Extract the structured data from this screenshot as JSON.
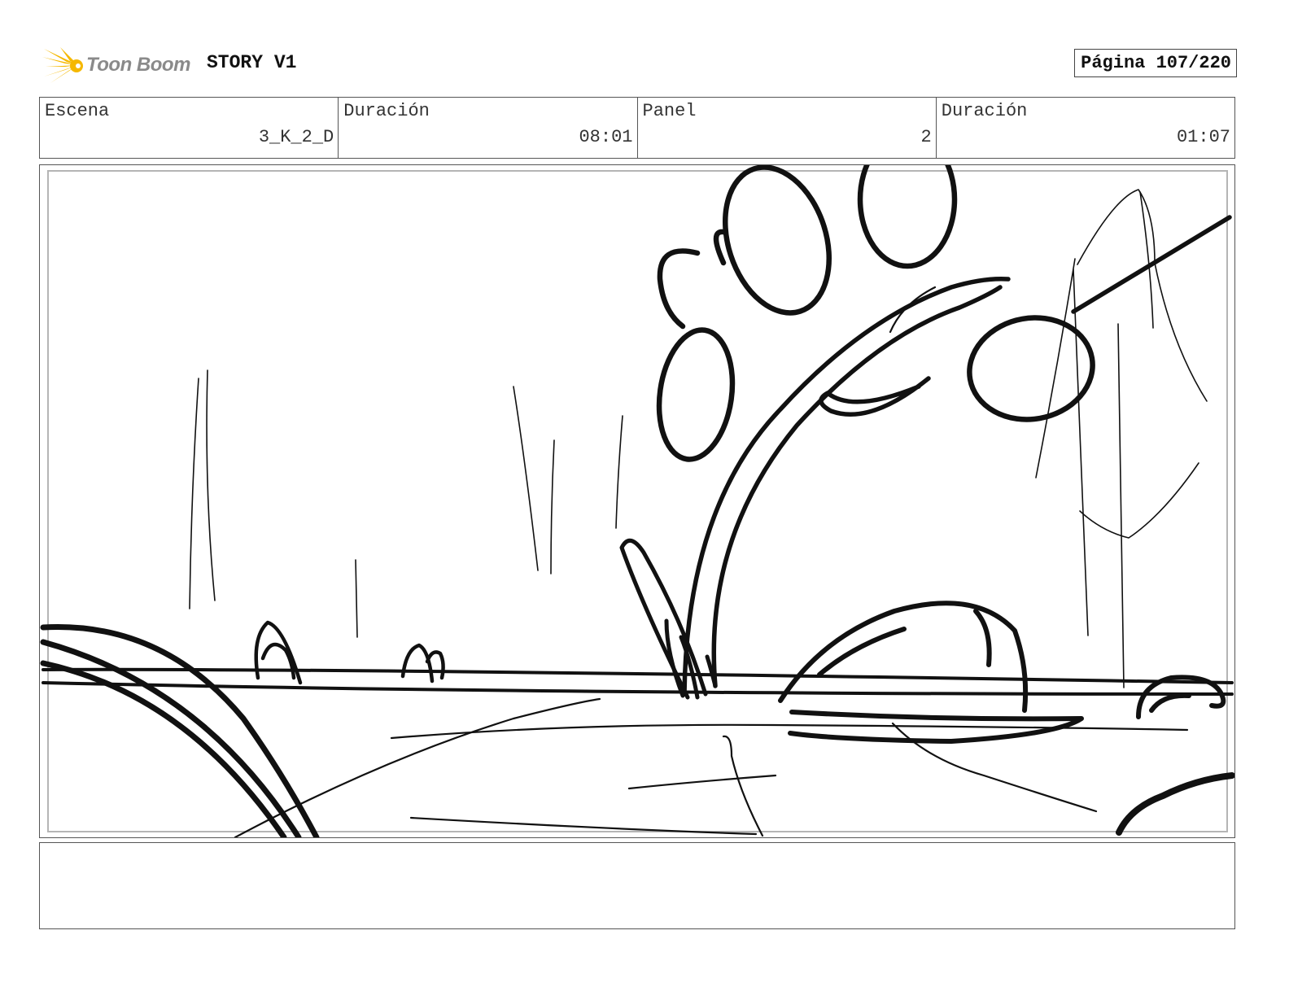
{
  "header": {
    "logo_text": "Toon Boom",
    "project_title": "STORY V1",
    "page_label": "Página 107/220",
    "logo_color": "#f5b800"
  },
  "info_row": {
    "scene_label": "Escena",
    "scene_value": "3_K_2_D",
    "scene_duration_label": "Duración",
    "scene_duration_value": "08:01",
    "panel_label": "Panel",
    "panel_value": "2",
    "panel_duration_label": "Duración",
    "panel_duration_value": "01:07"
  },
  "notes": {
    "text": ""
  }
}
